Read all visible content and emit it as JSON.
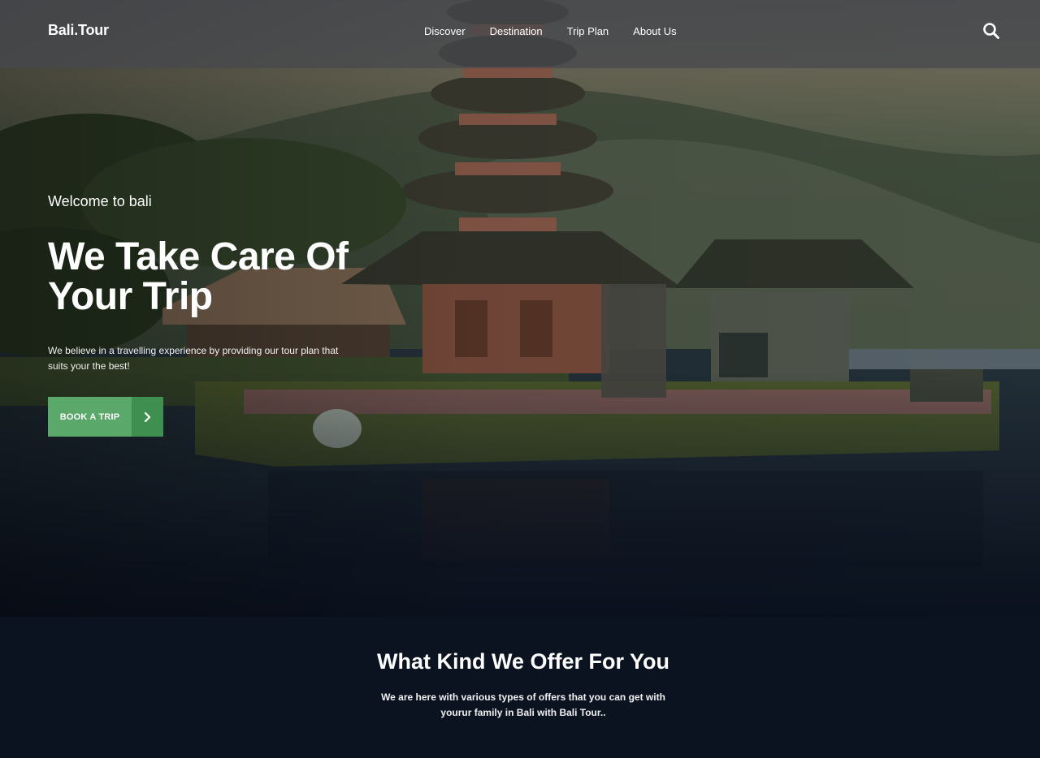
{
  "brand": {
    "name": "Bali.Tour"
  },
  "nav": {
    "items": [
      "Discover",
      "Destination",
      "Trip Plan",
      "About Us"
    ],
    "search_icon": "search-icon"
  },
  "hero": {
    "welcome": "Welcome to bali",
    "headline": "We Take Care Of Your Trip",
    "subtext": "We believe in a travelling experience by providing our tour plan that suits your the best!",
    "cta_label": "BOOK A TRIP",
    "cta_icon": "chevron-right-icon"
  },
  "offer": {
    "title": "What Kind We Offer For You",
    "text": "We are here with various types of offers that you can get with yourur family in Bali with Bali Tour.."
  },
  "colors": {
    "accent": "#5aa86a",
    "accent_dark": "#3f8f51",
    "background": "#0b1220",
    "header": "#4a4c52"
  }
}
